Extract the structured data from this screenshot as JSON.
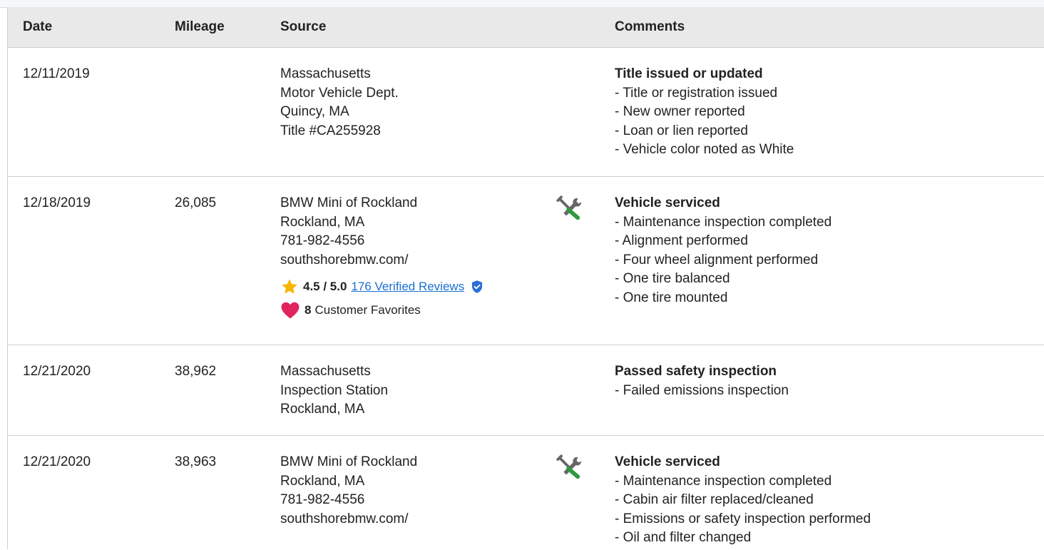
{
  "colors": {
    "header_bg": "#e9e9e9",
    "link": "#1a6fd1",
    "star": "#f7b500",
    "heart": "#e0245e",
    "verified_badge": "#2b6fd6",
    "icon_wrench_gray": "#666666",
    "icon_wrench_green": "#2e9a3e"
  },
  "table": {
    "headers": {
      "date": "Date",
      "mileage": "Mileage",
      "source": "Source",
      "comments": "Comments"
    },
    "rows": [
      {
        "date": "12/11/2019",
        "mileage": "",
        "source": [
          "Massachusetts",
          "Motor Vehicle Dept.",
          "Quincy, MA",
          "Title #CA255928"
        ],
        "icon": "",
        "comment_title": "Title issued or updated",
        "comment_items": [
          "- Title or registration issued",
          "- New owner reported",
          "- Loan or lien reported",
          "- Vehicle color noted as White"
        ]
      },
      {
        "date": "12/18/2019",
        "mileage": "26,085",
        "source": [
          "BMW Mini of Rockland",
          "Rockland, MA",
          "781-982-4556",
          "southshorebmw.com/"
        ],
        "icon": "service-tools-icon",
        "rating": {
          "score": "4.5 / 5.0",
          "reviews_link": "176 Verified Reviews",
          "favorites_count": "8",
          "favorites_label": "Customer Favorites"
        },
        "comment_title": "Vehicle serviced",
        "comment_items": [
          "- Maintenance inspection completed",
          "- Alignment performed",
          "- Four wheel alignment performed",
          "- One tire balanced",
          "- One tire mounted"
        ]
      },
      {
        "date": "12/21/2020",
        "mileage": "38,962",
        "source": [
          "Massachusetts",
          "Inspection Station",
          "Rockland, MA"
        ],
        "icon": "",
        "comment_title": "Passed safety inspection",
        "comment_items": [
          "- Failed emissions inspection"
        ]
      },
      {
        "date": "12/21/2020",
        "mileage": "38,963",
        "source": [
          "BMW Mini of Rockland",
          "Rockland, MA",
          "781-982-4556",
          "southshorebmw.com/"
        ],
        "icon": "service-tools-icon",
        "comment_title": "Vehicle serviced",
        "comment_items": [
          "- Maintenance inspection completed",
          "- Cabin air filter replaced/cleaned",
          "- Emissions or safety inspection performed",
          "- Oil and filter changed"
        ]
      }
    ]
  }
}
